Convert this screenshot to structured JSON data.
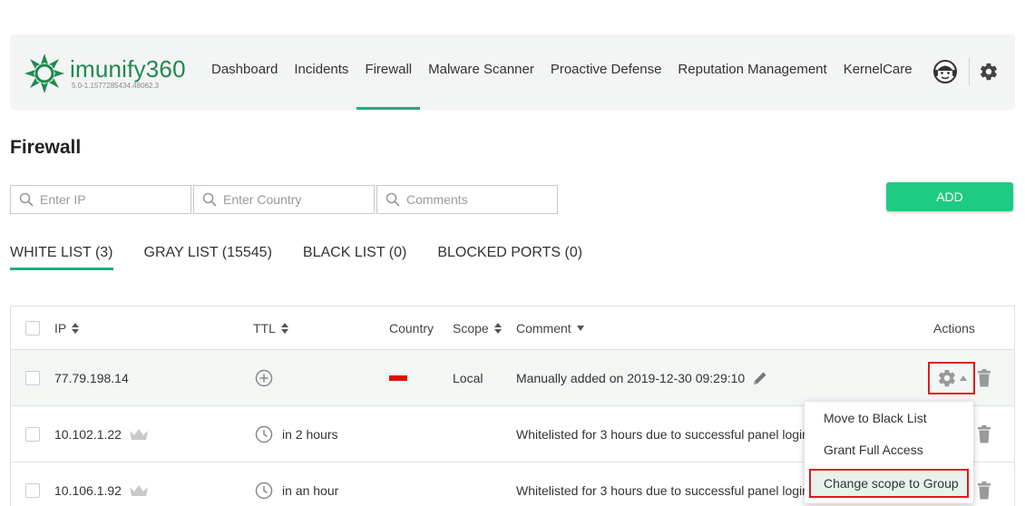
{
  "app": {
    "logo_text": "imunify360",
    "version": "5.0-1.1577285434.48062.3",
    "brand_color": "#1e8a4e",
    "accent_color": "#1eb07a"
  },
  "nav": {
    "items": [
      {
        "label": "Dashboard",
        "active": false
      },
      {
        "label": "Incidents",
        "active": false
      },
      {
        "label": "Firewall",
        "active": true
      },
      {
        "label": "Malware Scanner",
        "active": false
      },
      {
        "label": "Proactive Defense",
        "active": false
      },
      {
        "label": "Reputation Management",
        "active": false
      },
      {
        "label": "KernelCare",
        "active": false
      }
    ],
    "icons": [
      "support-agent-icon",
      "gear-icon"
    ]
  },
  "page": {
    "title": "Firewall"
  },
  "filters": {
    "ip_placeholder": "Enter IP",
    "country_placeholder": "Enter Country",
    "comments_placeholder": "Comments",
    "add_label": "ADD"
  },
  "tabs": [
    {
      "label": "WHITE LIST (3)",
      "active": true
    },
    {
      "label": "GRAY LIST (15545)",
      "active": false
    },
    {
      "label": "BLACK LIST (0)",
      "active": false
    },
    {
      "label": "BLOCKED PORTS (0)",
      "active": false
    }
  ],
  "table": {
    "columns": {
      "ip": "IP",
      "ttl": "TTL",
      "country": "Country",
      "scope": "Scope",
      "comment": "Comment",
      "actions": "Actions"
    },
    "rows": [
      {
        "ip": "77.79.198.14",
        "ttl": "",
        "country_flag_color": "#e00b0b",
        "scope": "Local",
        "comment": "Manually added on 2019-12-30 09:29:10"
      },
      {
        "ip": "10.102.1.22",
        "ttl": "in 2 hours",
        "scope": "",
        "comment": "Whitelisted for 3 hours due to successful panel login"
      },
      {
        "ip": "10.106.1.92",
        "ttl": "in an hour",
        "scope": "",
        "comment": "Whitelisted for 3 hours due to successful panel login"
      }
    ]
  },
  "actions_menu": {
    "items": [
      "Move to Black List",
      "Grant Full Access",
      "Change scope to Group"
    ],
    "highlight_color": "#e01b1b"
  }
}
